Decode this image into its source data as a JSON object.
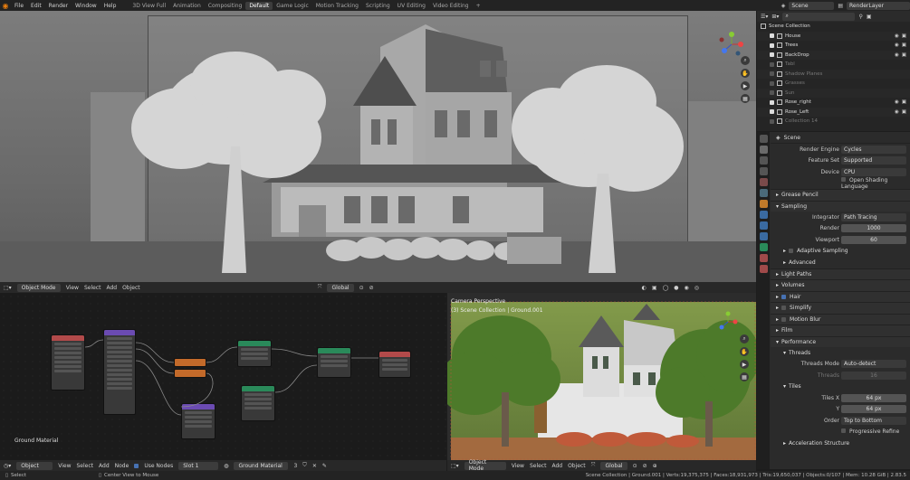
{
  "menu": [
    "File",
    "Edit",
    "Render",
    "Window",
    "Help"
  ],
  "workspaces": [
    {
      "label": "3D View Full",
      "active": false
    },
    {
      "label": "Animation",
      "active": false
    },
    {
      "label": "Compositing",
      "active": false
    },
    {
      "label": "Default",
      "active": true
    },
    {
      "label": "Game Logic",
      "active": false
    },
    {
      "label": "Motion Tracking",
      "active": false
    },
    {
      "label": "Scripting",
      "active": false
    },
    {
      "label": "UV Editing",
      "active": false
    },
    {
      "label": "Video Editing",
      "active": false
    }
  ],
  "topright": {
    "scene": "Scene",
    "view_layer": "RenderLayer"
  },
  "viewport3d": {
    "header": {
      "mode": "Object Mode",
      "menus": [
        "View",
        "Select",
        "Add",
        "Object"
      ],
      "transform": "Global"
    }
  },
  "outliner": {
    "root": "Scene Collection",
    "items": [
      {
        "label": "House",
        "enabled": true
      },
      {
        "label": "Trees",
        "enabled": true
      },
      {
        "label": "BackDrop",
        "enabled": true
      },
      {
        "label": "Tabl",
        "enabled": false
      },
      {
        "label": "Shadow Planes",
        "enabled": false
      },
      {
        "label": "Grasses",
        "enabled": false
      },
      {
        "label": "Sun",
        "enabled": false
      },
      {
        "label": "Rose_right",
        "enabled": true
      },
      {
        "label": "Rose_Left",
        "enabled": true
      },
      {
        "label": "Collection 14",
        "enabled": false
      }
    ]
  },
  "properties": {
    "scene_name": "Scene",
    "render_engine": {
      "label": "Render Engine",
      "value": "Cycles"
    },
    "feature_set": {
      "label": "Feature Set",
      "value": "Supported"
    },
    "device": {
      "label": "Device",
      "value": "CPU"
    },
    "osl": "Open Shading Language",
    "grease_pencil": "Grease Pencil",
    "sampling": "Sampling",
    "integrator": {
      "label": "Integrator",
      "value": "Path Tracing"
    },
    "render": {
      "label": "Render",
      "value": "1000"
    },
    "viewport": {
      "label": "Viewport",
      "value": "60"
    },
    "adaptive_sampling": "Adaptive Sampling",
    "advanced": "Advanced",
    "light_paths": "Light Paths",
    "volumes": "Volumes",
    "hair": "Hair",
    "simplify": "Simplify",
    "motion_blur": "Motion Blur",
    "film": "Film",
    "performance": "Performance",
    "threads": "Threads",
    "threads_mode": {
      "label": "Threads Mode",
      "value": "Auto-detect"
    },
    "threads_count": {
      "label": "Threads",
      "value": "16"
    },
    "tiles": "Tiles",
    "tiles_x": {
      "label": "Tiles X",
      "value": "64 px"
    },
    "tiles_y": {
      "label": "Y",
      "value": "64 px"
    },
    "order": {
      "label": "Order",
      "value": "Top to Bottom"
    },
    "progressive_refine": "Progressive Refine",
    "acceleration_structure": "Acceleration Structure"
  },
  "node_editor": {
    "material_label": "Ground Material",
    "header": {
      "mode": "Object",
      "menus": [
        "View",
        "Select",
        "Add",
        "Node"
      ],
      "use_nodes": "Use Nodes",
      "slot": "Slot 1",
      "material": "Ground Material",
      "users": "3"
    }
  },
  "camview": {
    "title": "Camera Perspective",
    "subtitle": "(3) Scene Collection | Ground.001",
    "header": {
      "mode": "Object Mode",
      "menus": [
        "View",
        "Select",
        "Add",
        "Object"
      ],
      "transform": "Global"
    }
  },
  "statusbar": {
    "left": "Select",
    "center": "Center View to Mouse",
    "right": "Scene Collection | Ground.001 | Verts:19,375,375 | Faces:18,931,973 | Tris:19,650,037 | Objects:0/107 | Mem: 10.28 GiB | 2.83.5"
  }
}
